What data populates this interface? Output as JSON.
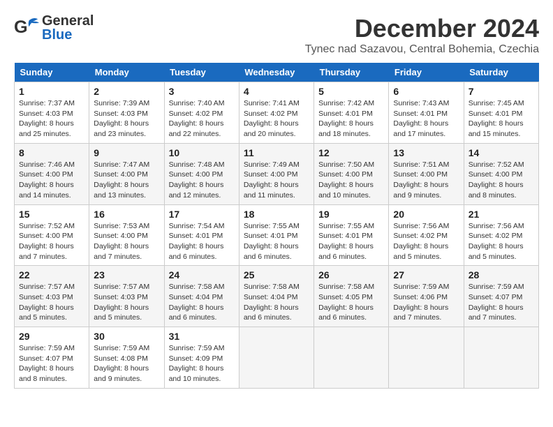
{
  "header": {
    "logo": {
      "general": "General",
      "blue": "Blue"
    },
    "title": "December 2024",
    "location": "Tynec nad Sazavou, Central Bohemia, Czechia"
  },
  "calendar": {
    "days": [
      "Sunday",
      "Monday",
      "Tuesday",
      "Wednesday",
      "Thursday",
      "Friday",
      "Saturday"
    ],
    "weeks": [
      [
        null,
        {
          "day": 2,
          "sunrise": "Sunrise: 7:39 AM",
          "sunset": "Sunset: 4:03 PM",
          "daylight": "Daylight: 8 hours and 23 minutes."
        },
        {
          "day": 3,
          "sunrise": "Sunrise: 7:40 AM",
          "sunset": "Sunset: 4:02 PM",
          "daylight": "Daylight: 8 hours and 22 minutes."
        },
        {
          "day": 4,
          "sunrise": "Sunrise: 7:41 AM",
          "sunset": "Sunset: 4:02 PM",
          "daylight": "Daylight: 8 hours and 20 minutes."
        },
        {
          "day": 5,
          "sunrise": "Sunrise: 7:42 AM",
          "sunset": "Sunset: 4:01 PM",
          "daylight": "Daylight: 8 hours and 18 minutes."
        },
        {
          "day": 6,
          "sunrise": "Sunrise: 7:43 AM",
          "sunset": "Sunset: 4:01 PM",
          "daylight": "Daylight: 8 hours and 17 minutes."
        },
        {
          "day": 7,
          "sunrise": "Sunrise: 7:45 AM",
          "sunset": "Sunset: 4:01 PM",
          "daylight": "Daylight: 8 hours and 15 minutes."
        }
      ],
      [
        {
          "day": 1,
          "sunrise": "Sunrise: 7:37 AM",
          "sunset": "Sunset: 4:03 PM",
          "daylight": "Daylight: 8 hours and 25 minutes."
        },
        null,
        null,
        null,
        null,
        null,
        null
      ],
      [
        {
          "day": 8,
          "sunrise": "Sunrise: 7:46 AM",
          "sunset": "Sunset: 4:00 PM",
          "daylight": "Daylight: 8 hours and 14 minutes."
        },
        {
          "day": 9,
          "sunrise": "Sunrise: 7:47 AM",
          "sunset": "Sunset: 4:00 PM",
          "daylight": "Daylight: 8 hours and 13 minutes."
        },
        {
          "day": 10,
          "sunrise": "Sunrise: 7:48 AM",
          "sunset": "Sunset: 4:00 PM",
          "daylight": "Daylight: 8 hours and 12 minutes."
        },
        {
          "day": 11,
          "sunrise": "Sunrise: 7:49 AM",
          "sunset": "Sunset: 4:00 PM",
          "daylight": "Daylight: 8 hours and 11 minutes."
        },
        {
          "day": 12,
          "sunrise": "Sunrise: 7:50 AM",
          "sunset": "Sunset: 4:00 PM",
          "daylight": "Daylight: 8 hours and 10 minutes."
        },
        {
          "day": 13,
          "sunrise": "Sunrise: 7:51 AM",
          "sunset": "Sunset: 4:00 PM",
          "daylight": "Daylight: 8 hours and 9 minutes."
        },
        {
          "day": 14,
          "sunrise": "Sunrise: 7:52 AM",
          "sunset": "Sunset: 4:00 PM",
          "daylight": "Daylight: 8 hours and 8 minutes."
        }
      ],
      [
        {
          "day": 15,
          "sunrise": "Sunrise: 7:52 AM",
          "sunset": "Sunset: 4:00 PM",
          "daylight": "Daylight: 8 hours and 7 minutes."
        },
        {
          "day": 16,
          "sunrise": "Sunrise: 7:53 AM",
          "sunset": "Sunset: 4:00 PM",
          "daylight": "Daylight: 8 hours and 7 minutes."
        },
        {
          "day": 17,
          "sunrise": "Sunrise: 7:54 AM",
          "sunset": "Sunset: 4:01 PM",
          "daylight": "Daylight: 8 hours and 6 minutes."
        },
        {
          "day": 18,
          "sunrise": "Sunrise: 7:55 AM",
          "sunset": "Sunset: 4:01 PM",
          "daylight": "Daylight: 8 hours and 6 minutes."
        },
        {
          "day": 19,
          "sunrise": "Sunrise: 7:55 AM",
          "sunset": "Sunset: 4:01 PM",
          "daylight": "Daylight: 8 hours and 6 minutes."
        },
        {
          "day": 20,
          "sunrise": "Sunrise: 7:56 AM",
          "sunset": "Sunset: 4:02 PM",
          "daylight": "Daylight: 8 hours and 5 minutes."
        },
        {
          "day": 21,
          "sunrise": "Sunrise: 7:56 AM",
          "sunset": "Sunset: 4:02 PM",
          "daylight": "Daylight: 8 hours and 5 minutes."
        }
      ],
      [
        {
          "day": 22,
          "sunrise": "Sunrise: 7:57 AM",
          "sunset": "Sunset: 4:03 PM",
          "daylight": "Daylight: 8 hours and 5 minutes."
        },
        {
          "day": 23,
          "sunrise": "Sunrise: 7:57 AM",
          "sunset": "Sunset: 4:03 PM",
          "daylight": "Daylight: 8 hours and 5 minutes."
        },
        {
          "day": 24,
          "sunrise": "Sunrise: 7:58 AM",
          "sunset": "Sunset: 4:04 PM",
          "daylight": "Daylight: 8 hours and 6 minutes."
        },
        {
          "day": 25,
          "sunrise": "Sunrise: 7:58 AM",
          "sunset": "Sunset: 4:04 PM",
          "daylight": "Daylight: 8 hours and 6 minutes."
        },
        {
          "day": 26,
          "sunrise": "Sunrise: 7:58 AM",
          "sunset": "Sunset: 4:05 PM",
          "daylight": "Daylight: 8 hours and 6 minutes."
        },
        {
          "day": 27,
          "sunrise": "Sunrise: 7:59 AM",
          "sunset": "Sunset: 4:06 PM",
          "daylight": "Daylight: 8 hours and 7 minutes."
        },
        {
          "day": 28,
          "sunrise": "Sunrise: 7:59 AM",
          "sunset": "Sunset: 4:07 PM",
          "daylight": "Daylight: 8 hours and 7 minutes."
        }
      ],
      [
        {
          "day": 29,
          "sunrise": "Sunrise: 7:59 AM",
          "sunset": "Sunset: 4:07 PM",
          "daylight": "Daylight: 8 hours and 8 minutes."
        },
        {
          "day": 30,
          "sunrise": "Sunrise: 7:59 AM",
          "sunset": "Sunset: 4:08 PM",
          "daylight": "Daylight: 8 hours and 9 minutes."
        },
        {
          "day": 31,
          "sunrise": "Sunrise: 7:59 AM",
          "sunset": "Sunset: 4:09 PM",
          "daylight": "Daylight: 8 hours and 10 minutes."
        },
        null,
        null,
        null,
        null
      ]
    ]
  }
}
